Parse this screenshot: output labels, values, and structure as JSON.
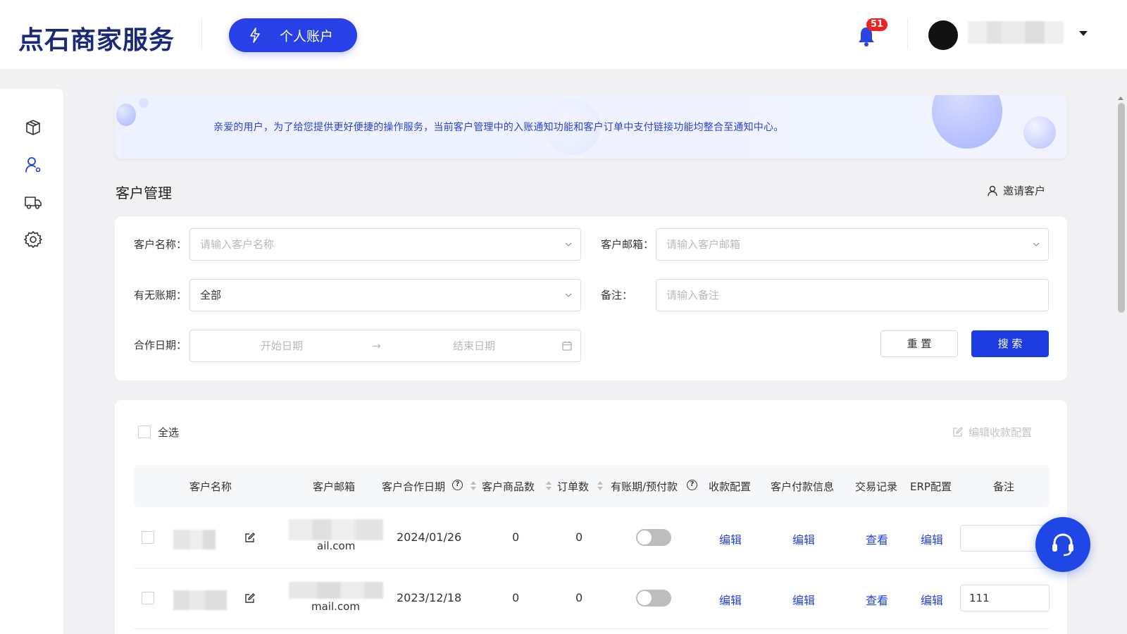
{
  "header": {
    "logo": "点石商家服务",
    "account_button": "个人账户",
    "notification_count": "51"
  },
  "banner": {
    "text": "亲爱的用户，为了给您提供更好便捷的操作服务，当前客户管理中的入账通知功能和客户订单中支付链接功能均整合至通知中心。"
  },
  "page": {
    "title": "客户管理",
    "invite_label": "邀请客户"
  },
  "filters": {
    "name_label": "客户名称：",
    "name_placeholder": "请输入客户名称",
    "email_label": "客户邮箱：",
    "email_placeholder": "请输入客户邮箱",
    "period_label": "有无账期：",
    "period_value": "全部",
    "note_label": "备注：",
    "note_placeholder": "请输入备注",
    "date_label": "合作日期：",
    "date_start_placeholder": "开始日期",
    "date_separator": "→",
    "date_end_placeholder": "结束日期",
    "reset_label": "重 置",
    "search_label": "搜 索"
  },
  "table": {
    "select_all": "全选",
    "edit_payment_config": "编辑收款配置",
    "headers": {
      "name": "客户名称",
      "email": "客户邮箱",
      "date": "客户合作日期",
      "products": "客户商品数",
      "orders": "订单数",
      "period": "有账期/预付款",
      "payment_config": "收款配置",
      "payment_info": "客户付款信息",
      "transactions": "交易记录",
      "erp": "ERP配置",
      "note": "备注"
    },
    "rows": [
      {
        "email_suffix": "ail.com",
        "date": "2024/01/26",
        "products": "0",
        "orders": "0",
        "period_enabled": false,
        "payment_config": "编辑",
        "payment_info": "编辑",
        "transactions": "查看",
        "erp": "编辑",
        "note": ""
      },
      {
        "email_suffix": "mail.com",
        "date": "2023/12/18",
        "products": "0",
        "orders": "0",
        "period_enabled": false,
        "payment_config": "编辑",
        "payment_info": "编辑",
        "transactions": "查看",
        "erp": "编辑",
        "note": "111"
      }
    ]
  },
  "colors": {
    "primary": "#1d3de3",
    "link": "#2443dd",
    "badge": "#f02020",
    "logo": "#1a2a7a"
  }
}
